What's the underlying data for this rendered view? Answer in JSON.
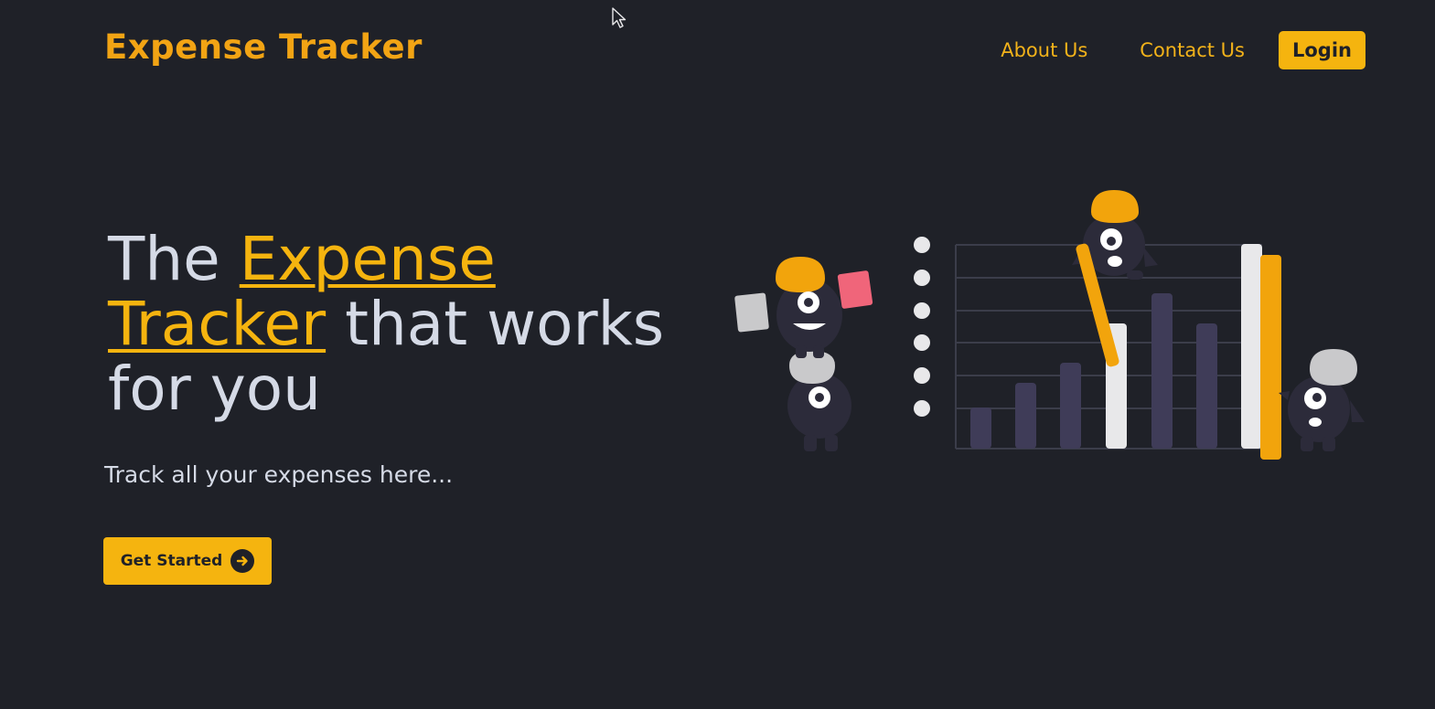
{
  "header": {
    "brand": "Expense Tracker",
    "nav": {
      "about_label": "About Us",
      "contact_label": "Contact Us",
      "login_label": "Login"
    }
  },
  "hero": {
    "title_the": "The ",
    "title_highlight_1": "Expense",
    "title_highlight_2": "Tracker",
    "title_rest": " that works for you",
    "subtitle": "Track all your expenses here...",
    "cta_label": "Get Started",
    "cta_icon": "arrow-right-circle-icon"
  },
  "colors": {
    "background": "#1f2128",
    "accent": "#f5b40f",
    "text": "#d5dae6"
  }
}
